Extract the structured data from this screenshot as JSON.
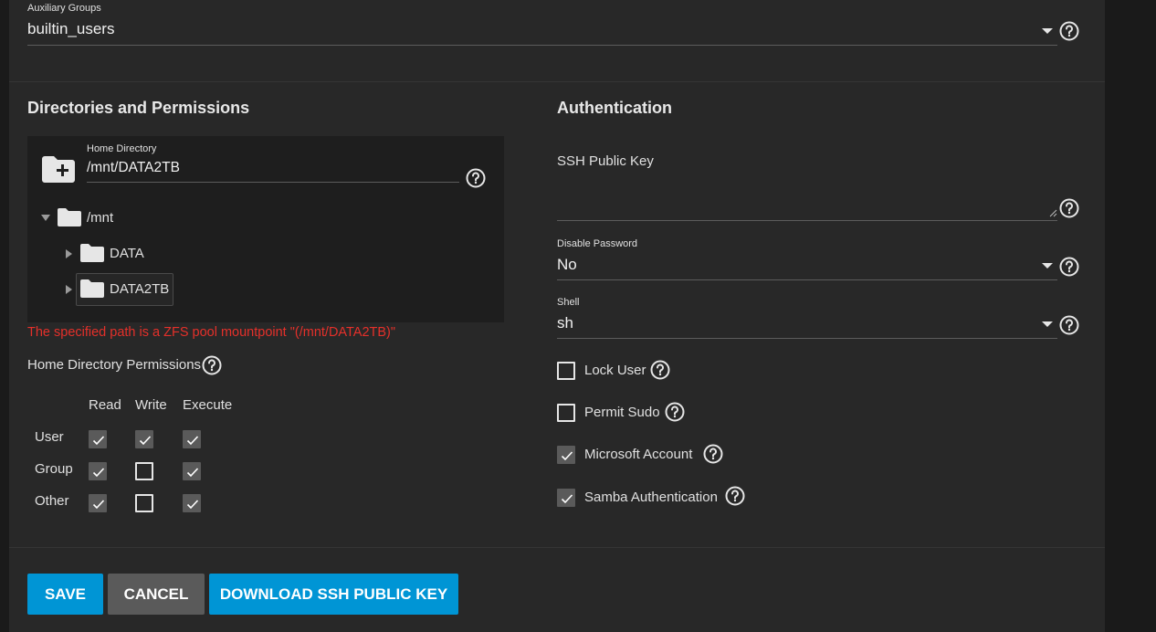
{
  "aux_groups": {
    "label": "Auxiliary Groups",
    "value": "builtin_users"
  },
  "directories": {
    "title": "Directories and Permissions",
    "home_label": "Home Directory",
    "home_value": "/mnt/DATA2TB",
    "tree": {
      "root": "/mnt",
      "children": [
        "DATA",
        "DATA2TB"
      ]
    },
    "error": "The specified path is a ZFS pool mountpoint \"(/mnt/DATA2TB)\"",
    "perm_title": "Home Directory Permissions",
    "perm_headers": [
      "Read",
      "Write",
      "Execute"
    ],
    "perm_rows": [
      {
        "label": "User",
        "values": [
          true,
          true,
          true
        ]
      },
      {
        "label": "Group",
        "values": [
          true,
          false,
          true
        ]
      },
      {
        "label": "Other",
        "values": [
          true,
          false,
          true
        ]
      }
    ]
  },
  "auth": {
    "title": "Authentication",
    "ssh_label": "SSH Public Key",
    "ssh_value": "",
    "disable_password_label": "Disable Password",
    "disable_password_value": "No",
    "shell_label": "Shell",
    "shell_value": "sh",
    "options": [
      {
        "label": "Lock User",
        "checked": false
      },
      {
        "label": "Permit Sudo",
        "checked": false
      },
      {
        "label": "Microsoft Account",
        "checked": true
      },
      {
        "label": "Samba Authentication",
        "checked": true
      }
    ]
  },
  "buttons": {
    "save": "SAVE",
    "cancel": "CANCEL",
    "download": "DOWNLOAD SSH PUBLIC KEY"
  },
  "colors": {
    "primary": "#0095d5",
    "secondary": "#5a5a5a",
    "error": "#e5302a",
    "card": "#282828"
  },
  "icons": {
    "help": "help-circle-icon",
    "folder": "folder-icon",
    "folder_add": "folder-plus-icon",
    "dropdown": "caret-down-icon",
    "check": "check-icon"
  }
}
